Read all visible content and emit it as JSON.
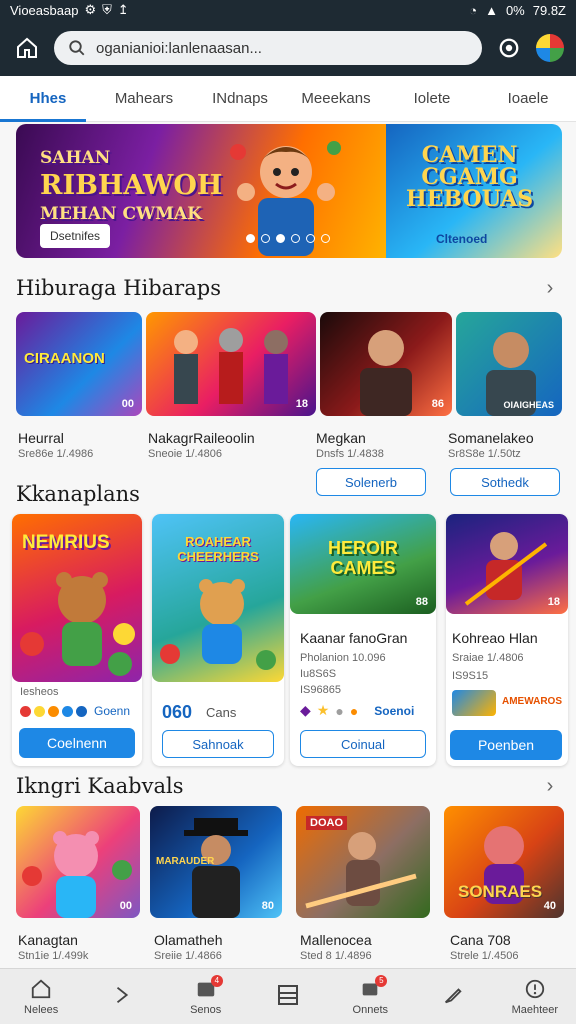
{
  "status": {
    "left_text": "Vioeasbaap",
    "time": "79.8Z",
    "battery": "0%"
  },
  "search": {
    "value": "oganianioi:lanlenaasan..."
  },
  "tabs": [
    {
      "label": "Hhes",
      "active": true
    },
    {
      "label": "Mahears"
    },
    {
      "label": "INdnaps"
    },
    {
      "label": "Meeekans"
    },
    {
      "label": "Iolete"
    },
    {
      "label": "Ioaele"
    }
  ],
  "hero": {
    "title_small": "SAHAN",
    "title_big": "RIBHAWOH",
    "title_sub": "MEHAN CWMAK",
    "button": "Dsetnifes",
    "side_title_1": "CAMEN",
    "side_title_2": "CGAMG",
    "side_title_3": "HEBOUAS",
    "side_badge": "Cltenoed"
  },
  "section1": {
    "title": "Hiburaga Hibaraps",
    "items": [
      {
        "name": "Heurral",
        "sub": "Sre86e 1/.4986",
        "badge": "00",
        "art": "CIRAANON"
      },
      {
        "name": "NakagrRaileoolin",
        "sub": "Sneoie 1/.4806",
        "badge": "18",
        "art": ""
      },
      {
        "name": "Megkan",
        "sub": "Dnsfs 1/.4838",
        "badge": "86",
        "art": "",
        "button": "Solenerb"
      },
      {
        "name": "Somanelakeo",
        "sub": "Sr8S8e 1/.50tz",
        "badge": "OIAIGHEAS",
        "art": "",
        "button": "Sothedk"
      }
    ]
  },
  "section2": {
    "title": "Kkanaplans",
    "items": [
      {
        "art": "NEMRIUS",
        "label_small": "Iesheos",
        "price": "Goenn",
        "button": "Coelnenn",
        "button_style": "fill"
      },
      {
        "art": "ROAHEAR CHEERHERS",
        "price_big": "060",
        "price": "Cans",
        "button": "Sahnoak",
        "button_style": "outline"
      },
      {
        "art": "HEROIR CAMES",
        "badge": "88",
        "name": "Kaanar fanoGran",
        "sub": "Pholanion 10.096",
        "sub2": "Iu8S6S",
        "sub3": "IS96865",
        "button": "Coinual",
        "button_style": "outline",
        "seller": "Soenoi"
      },
      {
        "badge": "18",
        "name": "Kohreao Hlan",
        "sub": "Sraiae 1/.4806",
        "sub2": "IS9S15",
        "art2": "AMEWAROS",
        "button": "Poenben",
        "button_style": "fill"
      }
    ]
  },
  "section3": {
    "title": "Ikngri Kaabvals",
    "items": [
      {
        "name": "Kanagtan",
        "sub": "Stn1ie 1/.499k",
        "badge": "00"
      },
      {
        "name": "Olamatheh",
        "sub": "Sreiie 1/.4866",
        "badge": "80",
        "art": "MARAUDER"
      },
      {
        "name": "Mallenocea",
        "sub": "Sted 8 1/.4896",
        "badge": "",
        "art": "DOAO"
      },
      {
        "name": "Cana 708",
        "sub": "Strele 1/.4506",
        "badge": "40",
        "art": "SONRAES"
      }
    ]
  },
  "bottom_nav": [
    {
      "label": "Nelees",
      "icon": "home-icon"
    },
    {
      "label": "",
      "icon": "search-icon"
    },
    {
      "label": "Senos",
      "icon": "games-icon",
      "badge": "4"
    },
    {
      "label": "",
      "icon": "library-icon"
    },
    {
      "label": "Onnets",
      "icon": "notifications-icon",
      "badge": "5"
    },
    {
      "label": "",
      "icon": "edit-icon"
    },
    {
      "label": "Maehteer",
      "icon": "info-icon"
    }
  ]
}
